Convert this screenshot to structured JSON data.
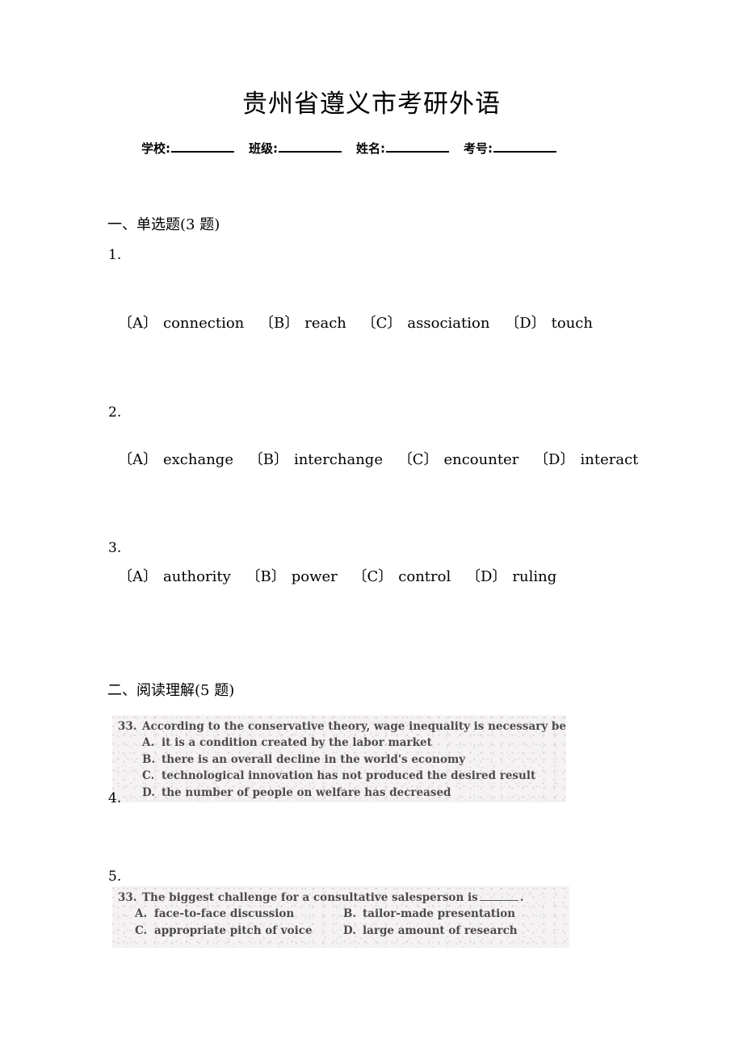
{
  "document": {
    "title": "贵州省遵义市考研外语"
  },
  "info_line": {
    "fields": [
      {
        "label": "学校:"
      },
      {
        "label": "班级:"
      },
      {
        "label": "姓名:"
      },
      {
        "label": "考号:"
      }
    ]
  },
  "sections": [
    {
      "heading": "一、单选题(3 题)"
    },
    {
      "heading": "二、阅读理解(5 题)"
    }
  ],
  "questions": {
    "q1": {
      "number": "1.",
      "options": [
        {
          "key": "〔A〕",
          "text": "connection"
        },
        {
          "key": "〔B〕",
          "text": "reach"
        },
        {
          "key": "〔C〕",
          "text": "association"
        },
        {
          "key": "〔D〕",
          "text": "touch"
        }
      ]
    },
    "q2": {
      "number": "2.",
      "options": [
        {
          "key": "〔A〕",
          "text": "exchange"
        },
        {
          "key": "〔B〕",
          "text": "interchange"
        },
        {
          "key": "〔C〕",
          "text": "encounter"
        },
        {
          "key": "〔D〕",
          "text": "interact"
        }
      ]
    },
    "q3": {
      "number": "3.",
      "options": [
        {
          "key": "〔A〕",
          "text": "authority"
        },
        {
          "key": "〔B〕",
          "text": "power"
        },
        {
          "key": "〔C〕",
          "text": "control"
        },
        {
          "key": "〔D〕",
          "text": "ruling"
        }
      ]
    },
    "q4": {
      "number": "4.",
      "scan": {
        "stem_number": "33.",
        "stem_text_before": "According to the conservative theory, wage inequality is necessary because",
        "stem_text_after": ".",
        "options": [
          {
            "letter": "A.",
            "text": "it is a condition created by the labor market"
          },
          {
            "letter": "B.",
            "text": "there is an overall decline in the world's economy"
          },
          {
            "letter": "C.",
            "text": "technological innovation has not produced the desired result"
          },
          {
            "letter": "D.",
            "text": "the number of people on welfare has decreased"
          }
        ]
      }
    },
    "q5": {
      "number": "5.",
      "scan": {
        "stem_number": "33.",
        "stem_text_before": "The biggest challenge for a consultative salesperson is",
        "stem_text_after": ".",
        "option_rows": [
          {
            "left": {
              "letter": "A.",
              "text": "face-to-face discussion"
            },
            "right": {
              "letter": "B.",
              "text": "tailor-made presentation"
            }
          },
          {
            "left": {
              "letter": "C.",
              "text": "appropriate pitch of voice"
            },
            "right": {
              "letter": "D.",
              "text": "large amount of research"
            }
          }
        ]
      }
    }
  }
}
